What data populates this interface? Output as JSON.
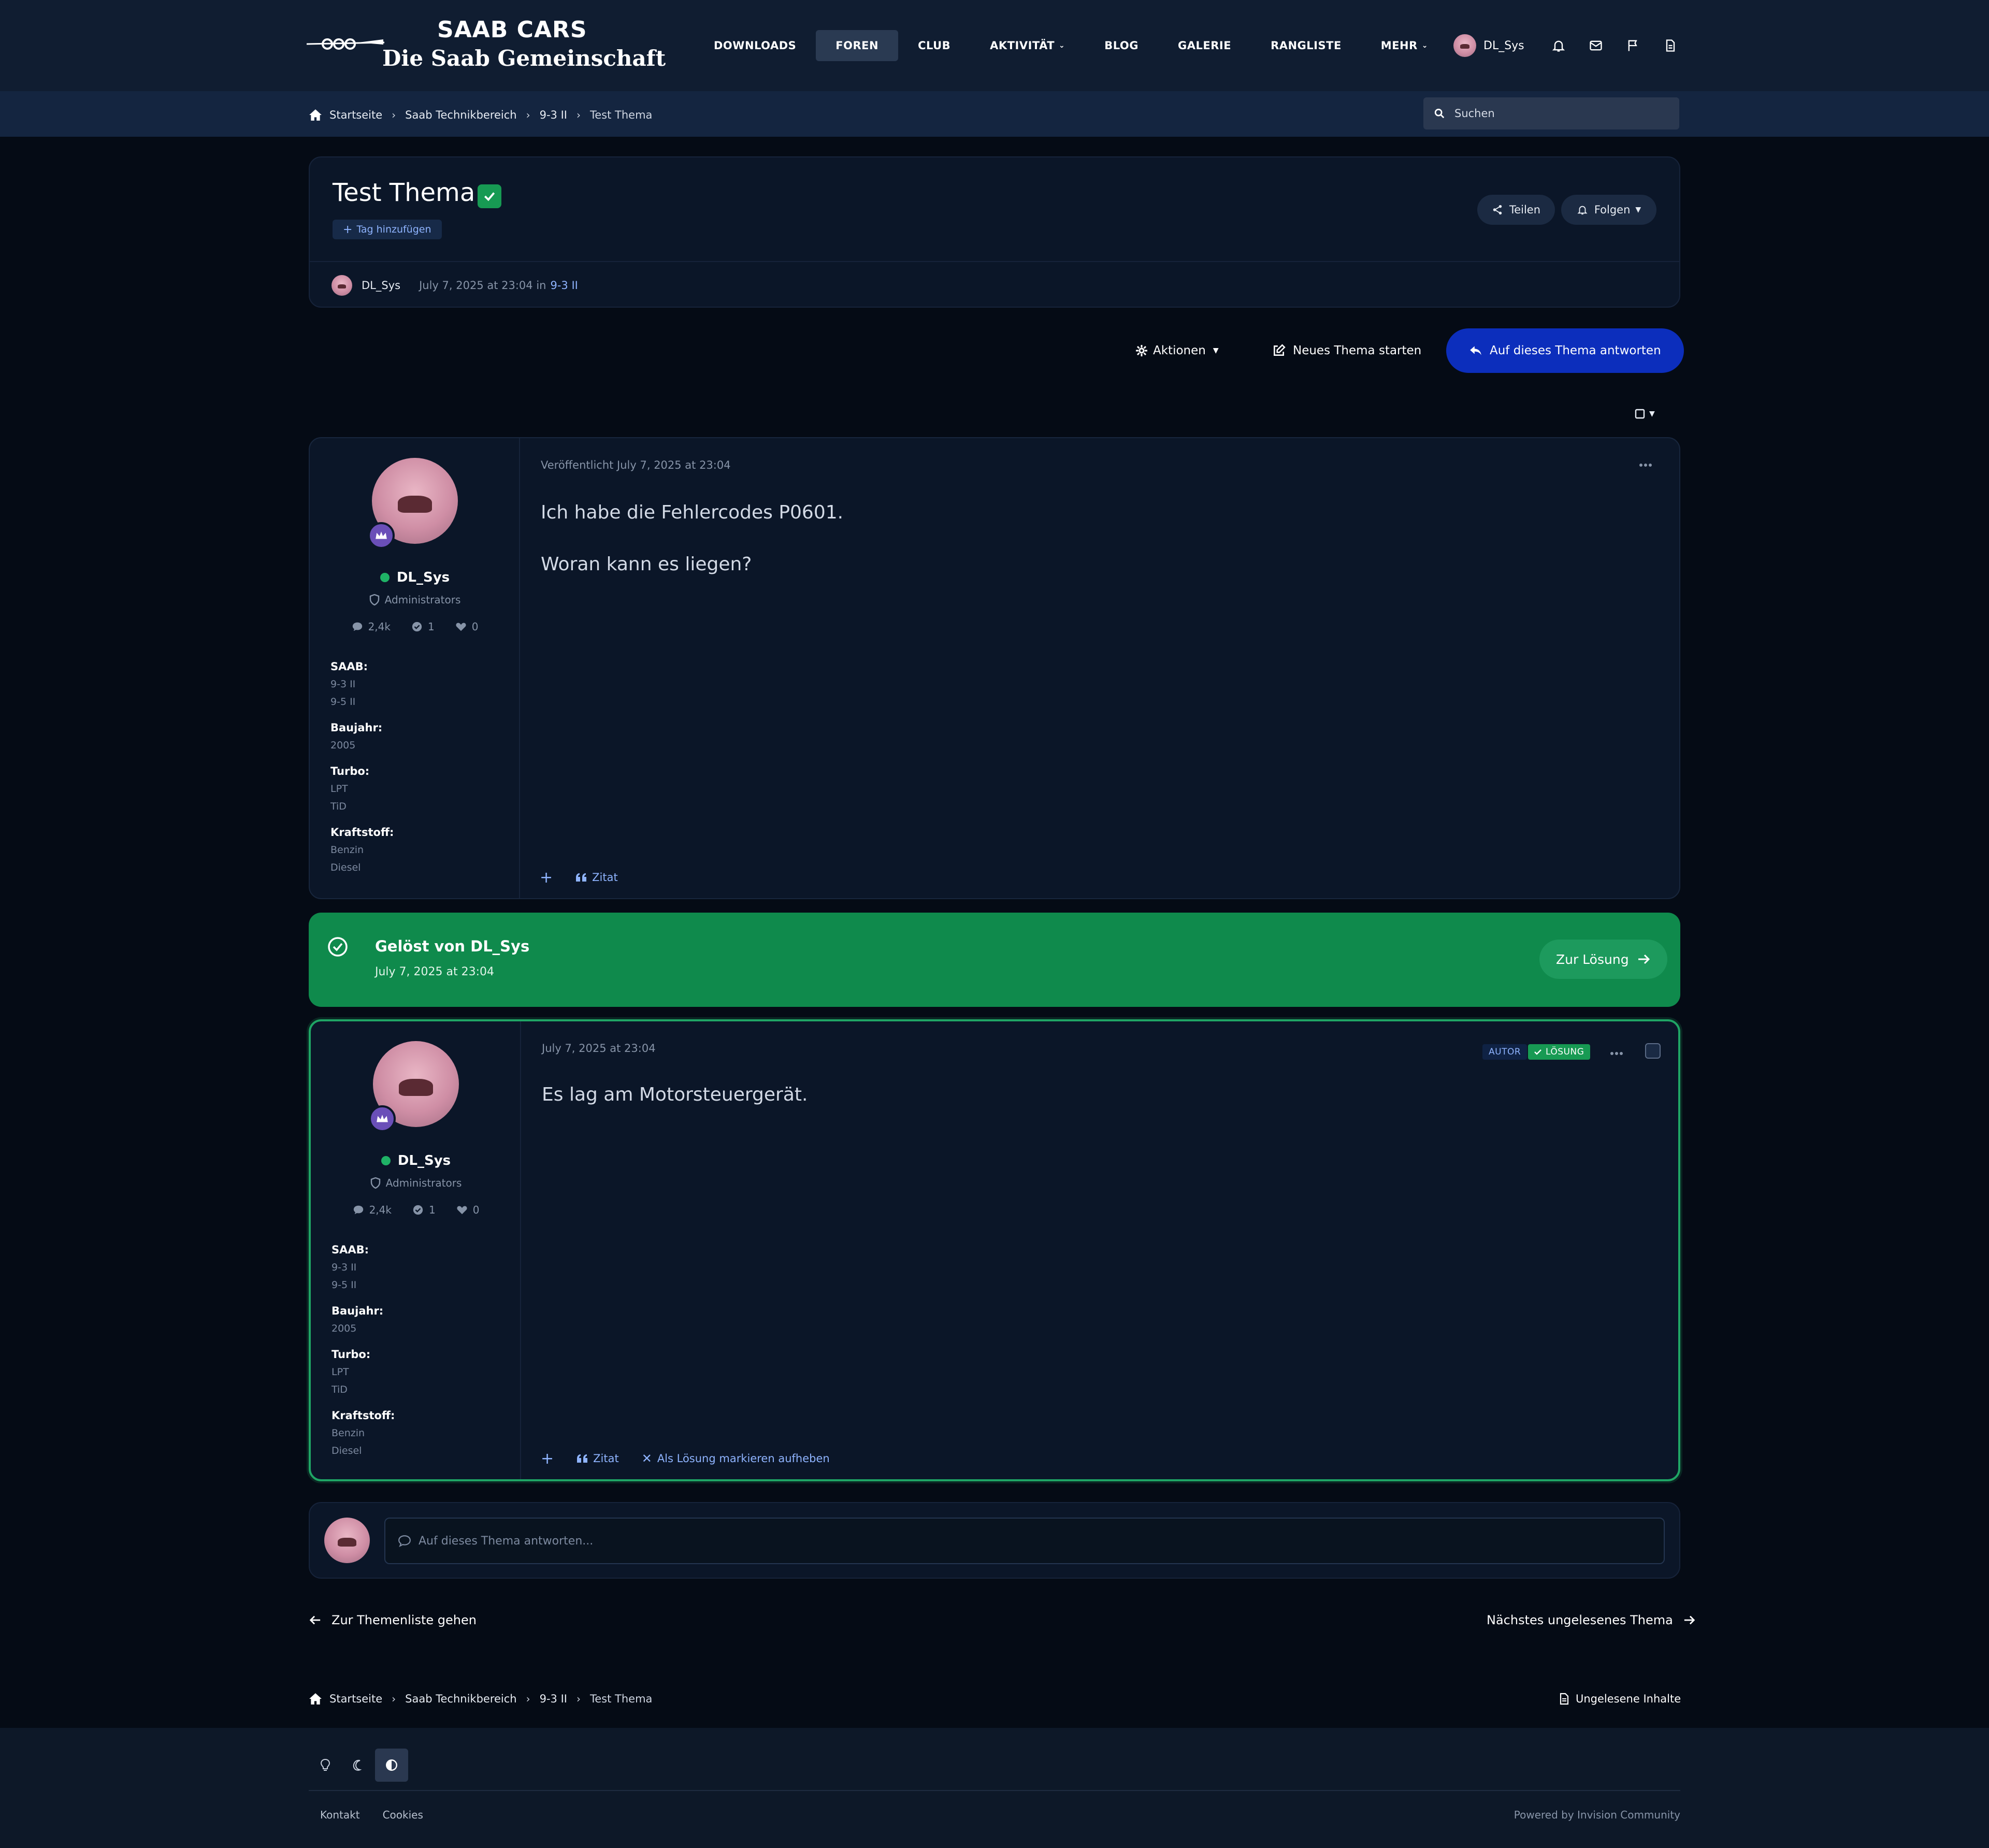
{
  "brand": {
    "title": "SAAB CARS",
    "subtitle": "Die Saab Gemeinschaft"
  },
  "nav": {
    "items": [
      {
        "label": "DOWNLOADS",
        "active": false,
        "dropdown": false
      },
      {
        "label": "FOREN",
        "active": true,
        "dropdown": false
      },
      {
        "label": "CLUB",
        "active": false,
        "dropdown": false
      },
      {
        "label": "AKTIVITÄT",
        "active": false,
        "dropdown": true
      },
      {
        "label": "BLOG",
        "active": false,
        "dropdown": false
      },
      {
        "label": "GALERIE",
        "active": false,
        "dropdown": false
      },
      {
        "label": "RANGLISTE",
        "active": false,
        "dropdown": false
      },
      {
        "label": "MEHR",
        "active": false,
        "dropdown": true
      }
    ]
  },
  "user": {
    "name": "DL_Sys",
    "icons": [
      "bell-icon",
      "envelope-icon",
      "flag-icon",
      "document-icon"
    ]
  },
  "breadcrumb": {
    "items": [
      "Startseite",
      "Saab Technikbereich",
      "9-3 II",
      "Test Thema"
    ]
  },
  "search": {
    "placeholder": "Suchen"
  },
  "topic": {
    "title": "Test Thema",
    "tag_add": "Tag hinzufügen",
    "share_label": "Teilen",
    "follow_label": "Folgen",
    "author": "DL_Sys",
    "date": "July 7, 2025 at 23:04 in",
    "forum": "9-3 II"
  },
  "actions": {
    "aktionen": "Aktionen",
    "new_topic": "Neues Thema starten",
    "reply": "Auf dieses Thema antworten"
  },
  "author_card": {
    "name": "DL_Sys",
    "group": "Administrators",
    "stats": {
      "posts": "2,4k",
      "solutions": "1",
      "reputation": "0"
    },
    "fields": [
      {
        "label": "SAAB:",
        "values": [
          "9-3 II",
          "9-5 II"
        ]
      },
      {
        "label": "Baujahr:",
        "values": [
          "2005"
        ]
      },
      {
        "label": "Turbo:",
        "values": [
          "LPT",
          "TiD"
        ]
      },
      {
        "label": "Kraftstoff:",
        "values": [
          "Benzin",
          "Diesel"
        ]
      }
    ]
  },
  "posts": [
    {
      "date": "Veröffentlicht July 7, 2025 at 23:04",
      "lines": [
        "Ich habe die Fehlercodes P0601.",
        "Woran kann es liegen?"
      ],
      "quote_label": "Zitat"
    },
    {
      "date": "July 7, 2025 at 23:04",
      "lines": [
        "Es lag am Motorsteuergerät."
      ],
      "quote_label": "Zitat",
      "unmark_label": "Als Lösung markieren aufheben",
      "badge_author": "AUTOR",
      "badge_solution": "LÖSUNG"
    }
  ],
  "solved": {
    "title": "Gelöst von DL_Sys",
    "date": "July 7, 2025 at 23:04",
    "button": "Zur Lösung"
  },
  "reply_box": {
    "placeholder": "Auf dieses Thema antworten..."
  },
  "bottom_nav": {
    "back": "Zur Themenliste gehen",
    "next": "Nächstes ungelesenes Thema"
  },
  "unread_label": "Ungelesene Inhalte",
  "footer": {
    "links": [
      "Kontakt",
      "Cookies"
    ],
    "powered": "Powered by Invision Community"
  },
  "colors": {
    "background": "#050b15",
    "header": "#101d31",
    "primary": "#0c2ebc",
    "success": "#0f8a4c",
    "link": "#8fb4ff"
  }
}
